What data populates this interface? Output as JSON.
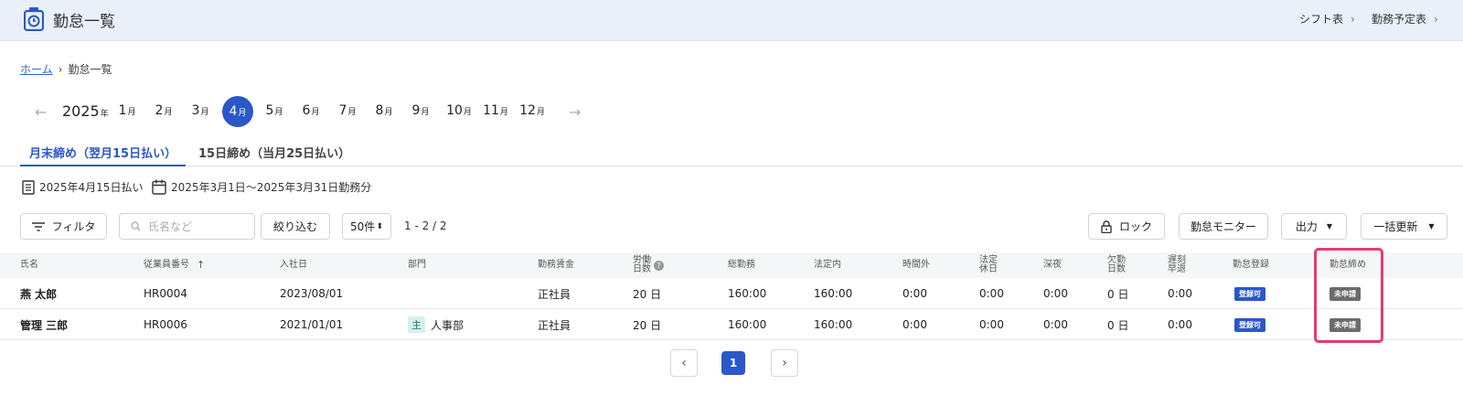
{
  "header": {
    "title": "勤怠一覧",
    "links": [
      "シフト表",
      "勤務予定表"
    ]
  },
  "breadcrumb": {
    "home": "ホーム",
    "current": "勤怠一覧"
  },
  "period": {
    "year": "2025",
    "year_suffix": "年",
    "month_suffix": "月",
    "months": [
      "1",
      "2",
      "3",
      "4",
      "5",
      "6",
      "7",
      "8",
      "9",
      "10",
      "11",
      "12"
    ],
    "selected": "4"
  },
  "tabs": [
    "月末締め（翌月15日払い）",
    "15日締め（当月25日払い）"
  ],
  "info": {
    "payday": "2025年4月15日払い",
    "range": "2025年3月1日〜2025年3月31日勤務分"
  },
  "toolbar": {
    "filter": "フィルタ",
    "search_placeholder": "氏名など",
    "narrow": "絞り込む",
    "per_page": "50件",
    "count": "1 - 2 / 2",
    "lock": "ロック",
    "monitor": "勤怠モニター",
    "export": "出力",
    "bulk_update": "一括更新"
  },
  "table": {
    "columns": {
      "name": "氏名",
      "emp_no": "従業員番号",
      "joined": "入社日",
      "dept": "部門",
      "wage": "勤務賃金",
      "workdays_a": "労働",
      "workdays_b": "日数",
      "total": "総勤務",
      "legal": "法定内",
      "overtime": "時間外",
      "holiday_a": "法定",
      "holiday_b": "休日",
      "night": "深夜",
      "absent_a": "欠勤",
      "absent_b": "日数",
      "late_a": "遅刻",
      "late_b": "早退",
      "registration": "勤怠登録",
      "closing": "勤怠締め"
    },
    "rows": [
      {
        "name": "燕 太郎",
        "emp_no": "HR0004",
        "joined": "2023/08/01",
        "dept_tag": "",
        "dept": "",
        "wage": "正社員",
        "workdays": "20 日",
        "total": "160:00",
        "legal": "160:00",
        "overtime": "0:00",
        "holiday": "0:00",
        "night": "0:00",
        "absent": "0 日",
        "late": "0:00",
        "registration": "登録可",
        "closing": "未申請"
      },
      {
        "name": "管理 三郎",
        "emp_no": "HR0006",
        "joined": "2021/01/01",
        "dept_tag": "主",
        "dept": "人事部",
        "wage": "正社員",
        "workdays": "20 日",
        "total": "160:00",
        "legal": "160:00",
        "overtime": "0:00",
        "holiday": "0:00",
        "night": "0:00",
        "absent": "0 日",
        "late": "0:00",
        "registration": "登録可",
        "closing": "未申請"
      }
    ]
  },
  "pagination": {
    "current": "1"
  },
  "colors": {
    "accent": "#2b58c8",
    "highlight": "#e63b6f",
    "header_bg": "#eaf0fa"
  }
}
